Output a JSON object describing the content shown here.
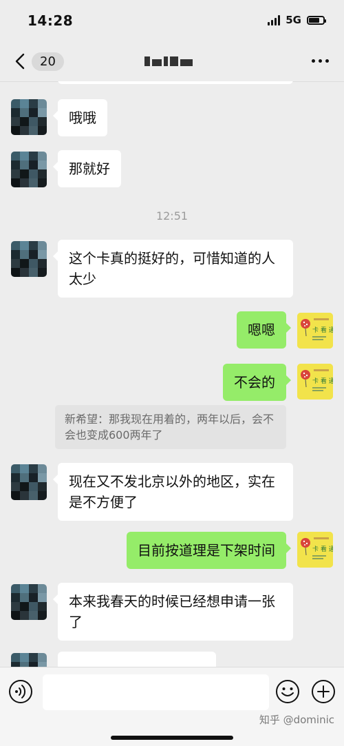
{
  "status_bar": {
    "time": "14:28",
    "network": "5G"
  },
  "nav": {
    "unread_count": "20"
  },
  "messages": [
    {
      "text": "哦哦"
    },
    {
      "text": "那就好"
    },
    {
      "time": "12:51"
    },
    {
      "text": "这个卡真的挺好的，可惜知道的人太少"
    },
    {
      "text": "嗯嗯"
    },
    {
      "text": "不会的"
    },
    {
      "quote": "新希望：那我现在用着的，两年以后，会不会也变成600两年了"
    },
    {
      "text": "现在又不发北京以外的地区，实在是不方便了"
    },
    {
      "text": "目前按道理是下架时间"
    },
    {
      "text": "本来我春天的时候已经想申请一张了"
    }
  ],
  "input": {
    "placeholder": ""
  },
  "watermark": "知乎 @dominic",
  "icons": {
    "back": "chevron-left-icon",
    "more": "more-dots-icon",
    "voice": "voice-icon",
    "emoji": "emoji-icon",
    "plus": "plus-icon"
  },
  "colors": {
    "background": "#ededed",
    "incoming_bubble": "#ffffff",
    "outgoing_bubble": "#95ec69",
    "quote_bg": "#e3e3e3"
  }
}
